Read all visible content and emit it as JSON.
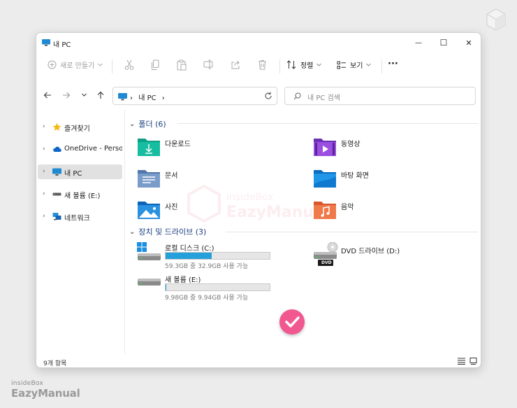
{
  "window": {
    "title": "내 PC"
  },
  "controls": {
    "minimize": "—",
    "maximize": "☐",
    "close": "✕"
  },
  "toolbar": {
    "new_label": "새로 만들기",
    "sort_label": "정렬",
    "view_label": "보기",
    "more_label": "···"
  },
  "address": {
    "crumb": "내 PC",
    "crumb_sep": "›",
    "search_placeholder": "내 PC 검색"
  },
  "sidebar": {
    "items": [
      {
        "label": "즐겨찾기",
        "icon": "star-icon"
      },
      {
        "label": "OneDrive - Personal",
        "icon": "cloud-icon"
      },
      {
        "label": "내 PC",
        "icon": "pc-icon",
        "selected": true
      },
      {
        "label": "새 볼륨 (E:)",
        "icon": "drive-icon"
      },
      {
        "label": "네트워크",
        "icon": "network-icon"
      }
    ]
  },
  "folders_section": {
    "title": "폴더 (6)"
  },
  "folders": [
    {
      "label": "다운로드",
      "icon": "download-folder-icon"
    },
    {
      "label": "동영상",
      "icon": "video-folder-icon"
    },
    {
      "label": "문서",
      "icon": "document-folder-icon"
    },
    {
      "label": "바탕 화면",
      "icon": "desktop-folder-icon"
    },
    {
      "label": "사진",
      "icon": "pictures-folder-icon"
    },
    {
      "label": "음악",
      "icon": "music-folder-icon"
    }
  ],
  "drives_section": {
    "title": "장치 및 드라이브 (3)"
  },
  "drives": [
    {
      "name": "로컬 디스크 (C:)",
      "info": "59.3GB 중 32.9GB 사용 가능",
      "used_fraction": 0.445
    },
    {
      "name": "DVD 드라이브 (D:)",
      "info": "",
      "dvd_label": "DVD"
    },
    {
      "name": "새 볼륨 (E:)",
      "info": "9.98GB 중 9.94GB 사용 가능",
      "used_fraction": 0.004
    }
  ],
  "status": {
    "count": "9개 항목"
  },
  "watermarks": {
    "brand_small": "insideBox",
    "brand_large": "EazyManual"
  },
  "colors": {
    "accent": "#26a0da",
    "section": "#1a3f80",
    "check": "#f0588f",
    "selected": "#e1e1e1"
  }
}
